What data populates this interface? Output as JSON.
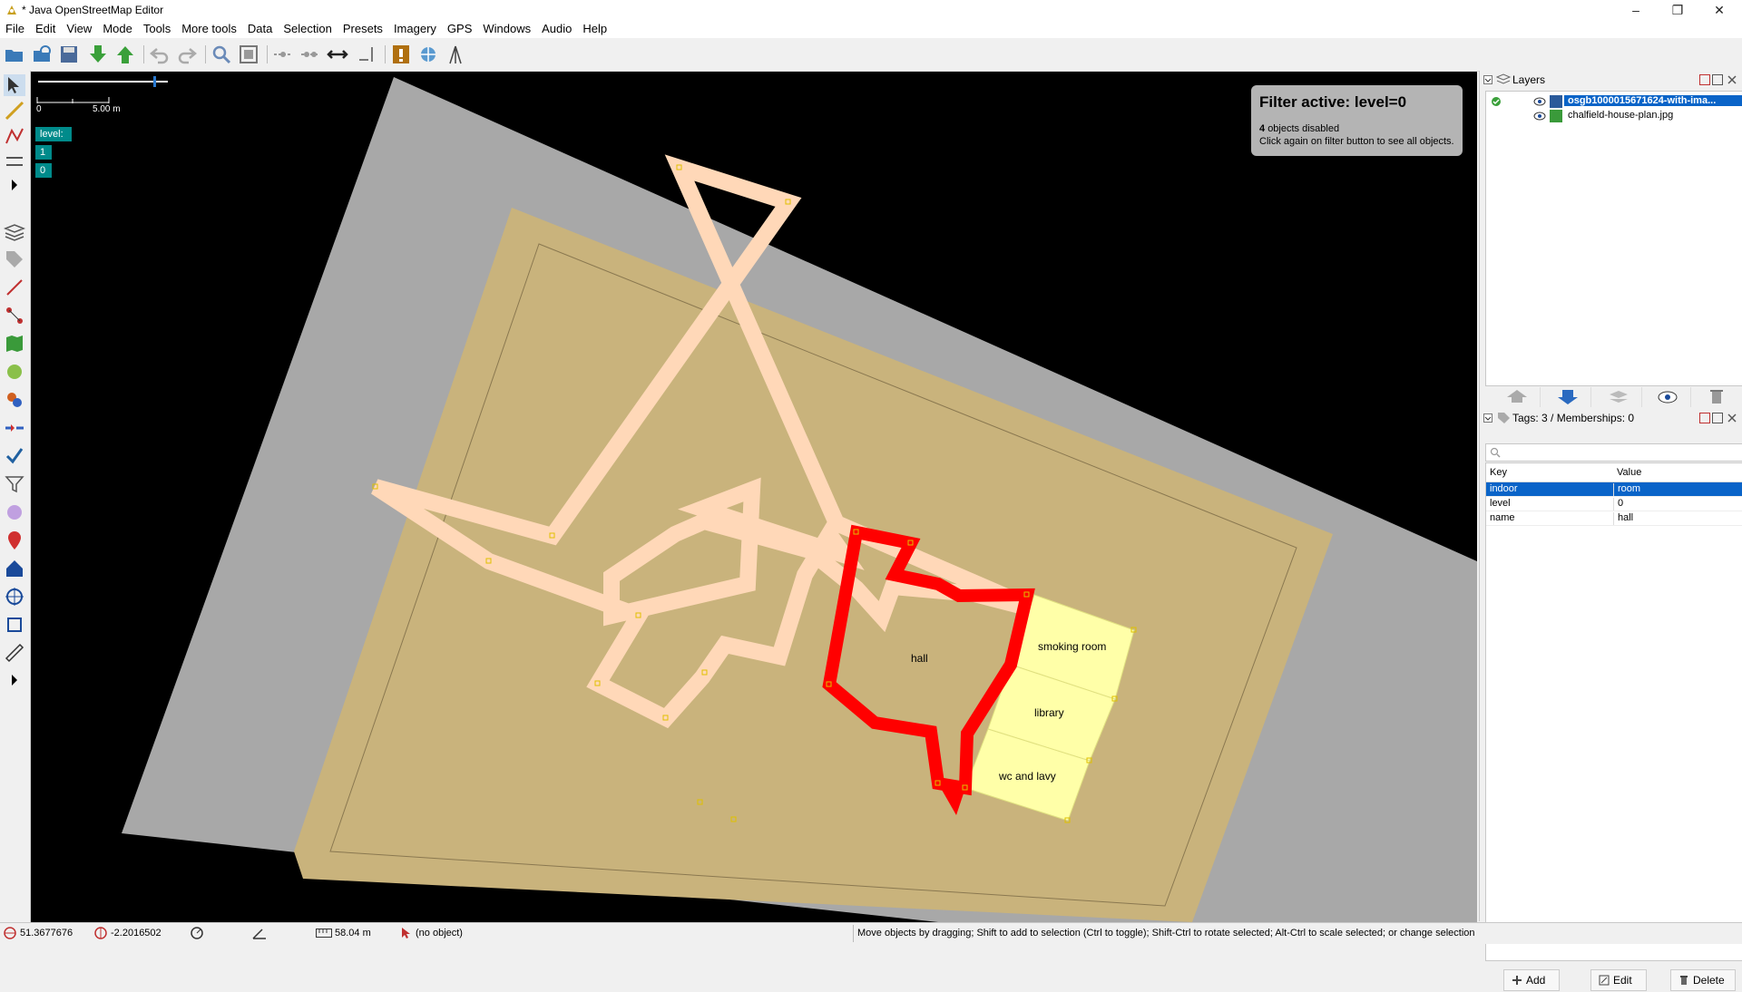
{
  "window": {
    "title": "* Java OpenStreetMap Editor"
  },
  "menu": [
    "File",
    "Edit",
    "View",
    "Mode",
    "Tools",
    "More tools",
    "Data",
    "Selection",
    "Presets",
    "Imagery",
    "GPS",
    "Windows",
    "Audio",
    "Help"
  ],
  "map": {
    "scale_zero": "0",
    "scale_label": "5.00 m",
    "level_title": "level:",
    "levels": [
      "1",
      "0"
    ],
    "rooms": {
      "hall": "hall",
      "smoking_room": "smoking room",
      "library": "library",
      "wc": "wc and lavy"
    },
    "filter": {
      "title": "Filter active: level=0",
      "count": "4",
      "disabled_text": "objects disabled",
      "hint": "Click again on filter button to see all objects."
    }
  },
  "layers_panel": {
    "title": "Layers",
    "layers": [
      {
        "name": "osgb1000015671624-with-ima...",
        "selected": true
      },
      {
        "name": "chalfield-house-plan.jpg",
        "selected": false
      }
    ]
  },
  "tags_panel": {
    "title": "Tags: 3 / Memberships: 0",
    "search_placeholder": "",
    "col_key": "Key",
    "col_value": "Value",
    "rows": [
      {
        "key": "indoor",
        "value": "room"
      },
      {
        "key": "level",
        "value": "0"
      },
      {
        "key": "name",
        "value": "hall"
      }
    ],
    "add_label": "Add",
    "edit_label": "Edit",
    "delete_label": "Delete"
  },
  "status": {
    "lat": "51.3677676",
    "lon": "-2.2016502",
    "distance": "58.04 m",
    "object": "(no object)",
    "help": "Move objects by dragging; Shift to add to selection (Ctrl to toggle); Shift-Ctrl to rotate selected; Alt-Ctrl to scale selected; or change selection"
  },
  "colors": {
    "selected_way": "#ff0000",
    "corridor_fill": "#ffd8b8",
    "room_fill": "#ffffa8",
    "level_badge": "#008b8b",
    "selection_blue": "#0a64c8"
  }
}
